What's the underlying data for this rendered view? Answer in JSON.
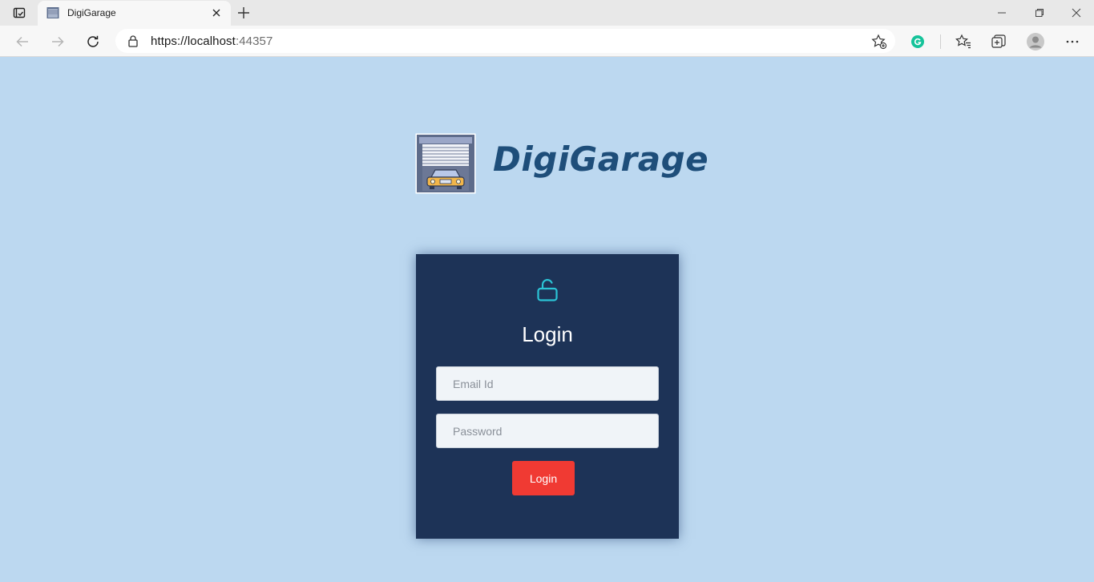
{
  "browser": {
    "tab_title": "DigiGarage",
    "url_host": "https://localhost",
    "url_port": ":44357"
  },
  "brand": {
    "name": "DigiGarage"
  },
  "login": {
    "title": "Login",
    "email_placeholder": "Email Id",
    "password_placeholder": "Password",
    "button_label": "Login"
  },
  "colors": {
    "page_background": "#bcd8f0",
    "card_background": "#1d3357",
    "accent_icon": "#2bc4d6",
    "button": "#f03a33",
    "brand_text": "#1e4e7a"
  },
  "icons": {
    "tab_actions": "tab-actions-icon",
    "favicon": "garage-favicon-icon",
    "close": "close-icon",
    "new_tab": "plus-icon",
    "back": "back-arrow-icon",
    "forward": "forward-arrow-icon",
    "refresh": "refresh-icon",
    "lock": "lock-icon",
    "add_favorite": "add-favorite-icon",
    "grammarly": "grammarly-icon",
    "favorites": "favorites-icon",
    "collections": "collections-icon",
    "profile": "profile-icon",
    "more": "more-icon",
    "unlock": "unlock-icon"
  }
}
